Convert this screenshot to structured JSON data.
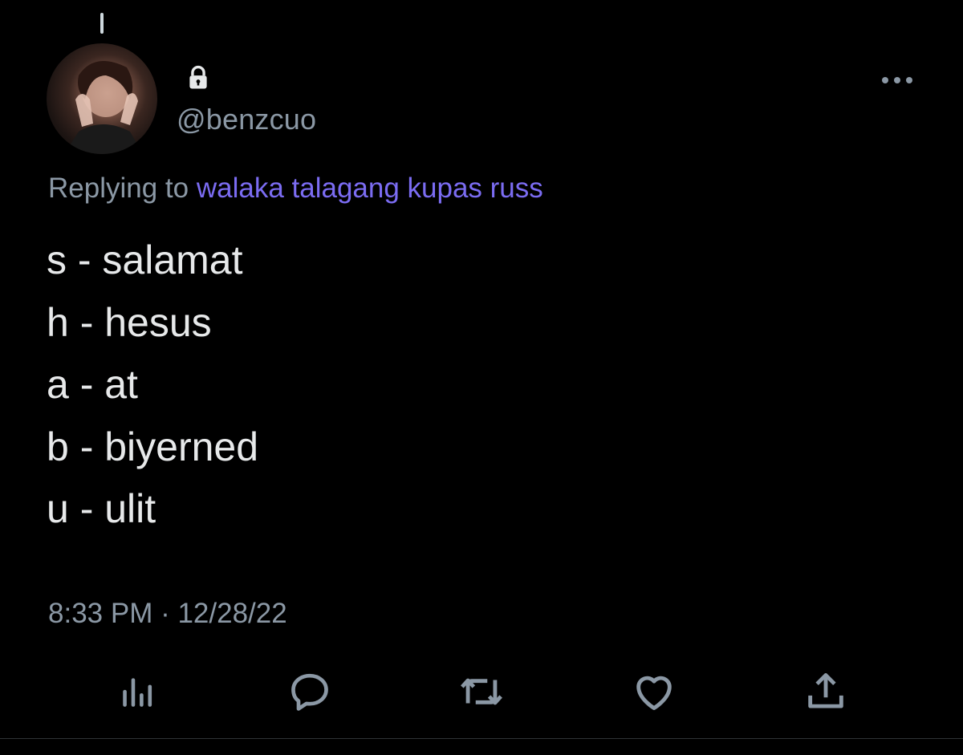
{
  "profile": {
    "handle": "@benzcuo",
    "protected": true
  },
  "reply_context": {
    "prefix": "Replying to",
    "mention": "walaka talagang kupas russ"
  },
  "tweet": {
    "lines": [
      "s - salamat",
      "h - hesus",
      "a - at",
      "b - biyerned",
      "u - ulit"
    ],
    "timestamp": "8:33 PM · 12/28/22"
  },
  "actions": [
    "analytics-icon",
    "reply-icon",
    "retweet-icon",
    "like-icon",
    "share-icon"
  ],
  "colors": {
    "background": "#000000",
    "text": "#e7e9ea",
    "secondary_text": "#8b98a5",
    "mention": "#7b6cf2",
    "icon": "#8b98a5"
  }
}
